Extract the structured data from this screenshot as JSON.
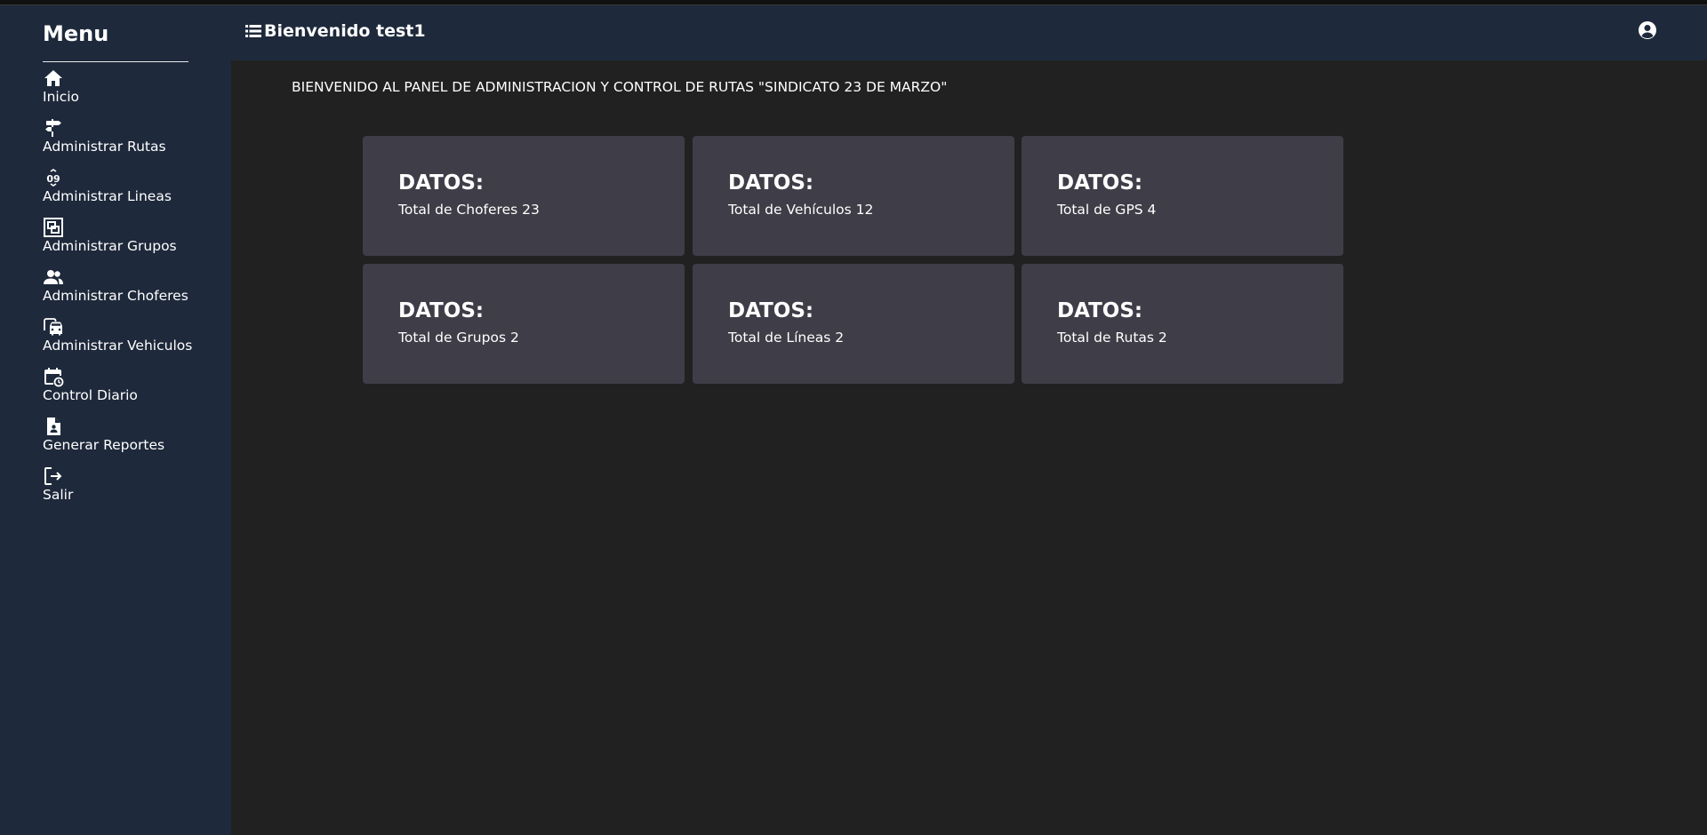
{
  "sidebar": {
    "title": "Menu",
    "items": [
      {
        "label": "Inicio",
        "icon": "home-icon"
      },
      {
        "label": "Administrar Rutas",
        "icon": "signpost-icon"
      },
      {
        "label": "Administrar Lineas",
        "icon": "line-number-icon"
      },
      {
        "label": "Administrar Grupos",
        "icon": "group-box-icon"
      },
      {
        "label": "Administrar Choferes",
        "icon": "people-icon"
      },
      {
        "label": "Administrar Vehiculos",
        "icon": "vehicles-icon"
      },
      {
        "label": "Control Diario",
        "icon": "calendar-clock-icon"
      },
      {
        "label": "Generar Reportes",
        "icon": "report-icon"
      },
      {
        "label": "Salir",
        "icon": "logout-icon"
      }
    ],
    "line_icon_text": "09"
  },
  "header": {
    "title": "Bienvenido test1",
    "menu_icon": "list-icon",
    "user_icon": "user-circle-icon"
  },
  "main": {
    "welcome": "BIENVENIDO AL PANEL DE ADMINISTRACION Y CONTROL DE RUTAS \"SINDICATO 23 DE MARZO\"",
    "cards": [
      {
        "title": "DATOS:",
        "text": "Total de Choferes 23"
      },
      {
        "title": "DATOS:",
        "text": "Total de Vehículos 12"
      },
      {
        "title": "DATOS:",
        "text": "Total de GPS 4"
      },
      {
        "title": "DATOS:",
        "text": "Total de Grupos 2"
      },
      {
        "title": "DATOS:",
        "text": "Total de Líneas 2"
      },
      {
        "title": "DATOS:",
        "text": "Total de Rutas 2"
      }
    ]
  },
  "colors": {
    "sidebar_bg": "#1e293b",
    "content_bg": "#212121",
    "card_bg": "#3f3d47",
    "text": "#ffffff"
  }
}
